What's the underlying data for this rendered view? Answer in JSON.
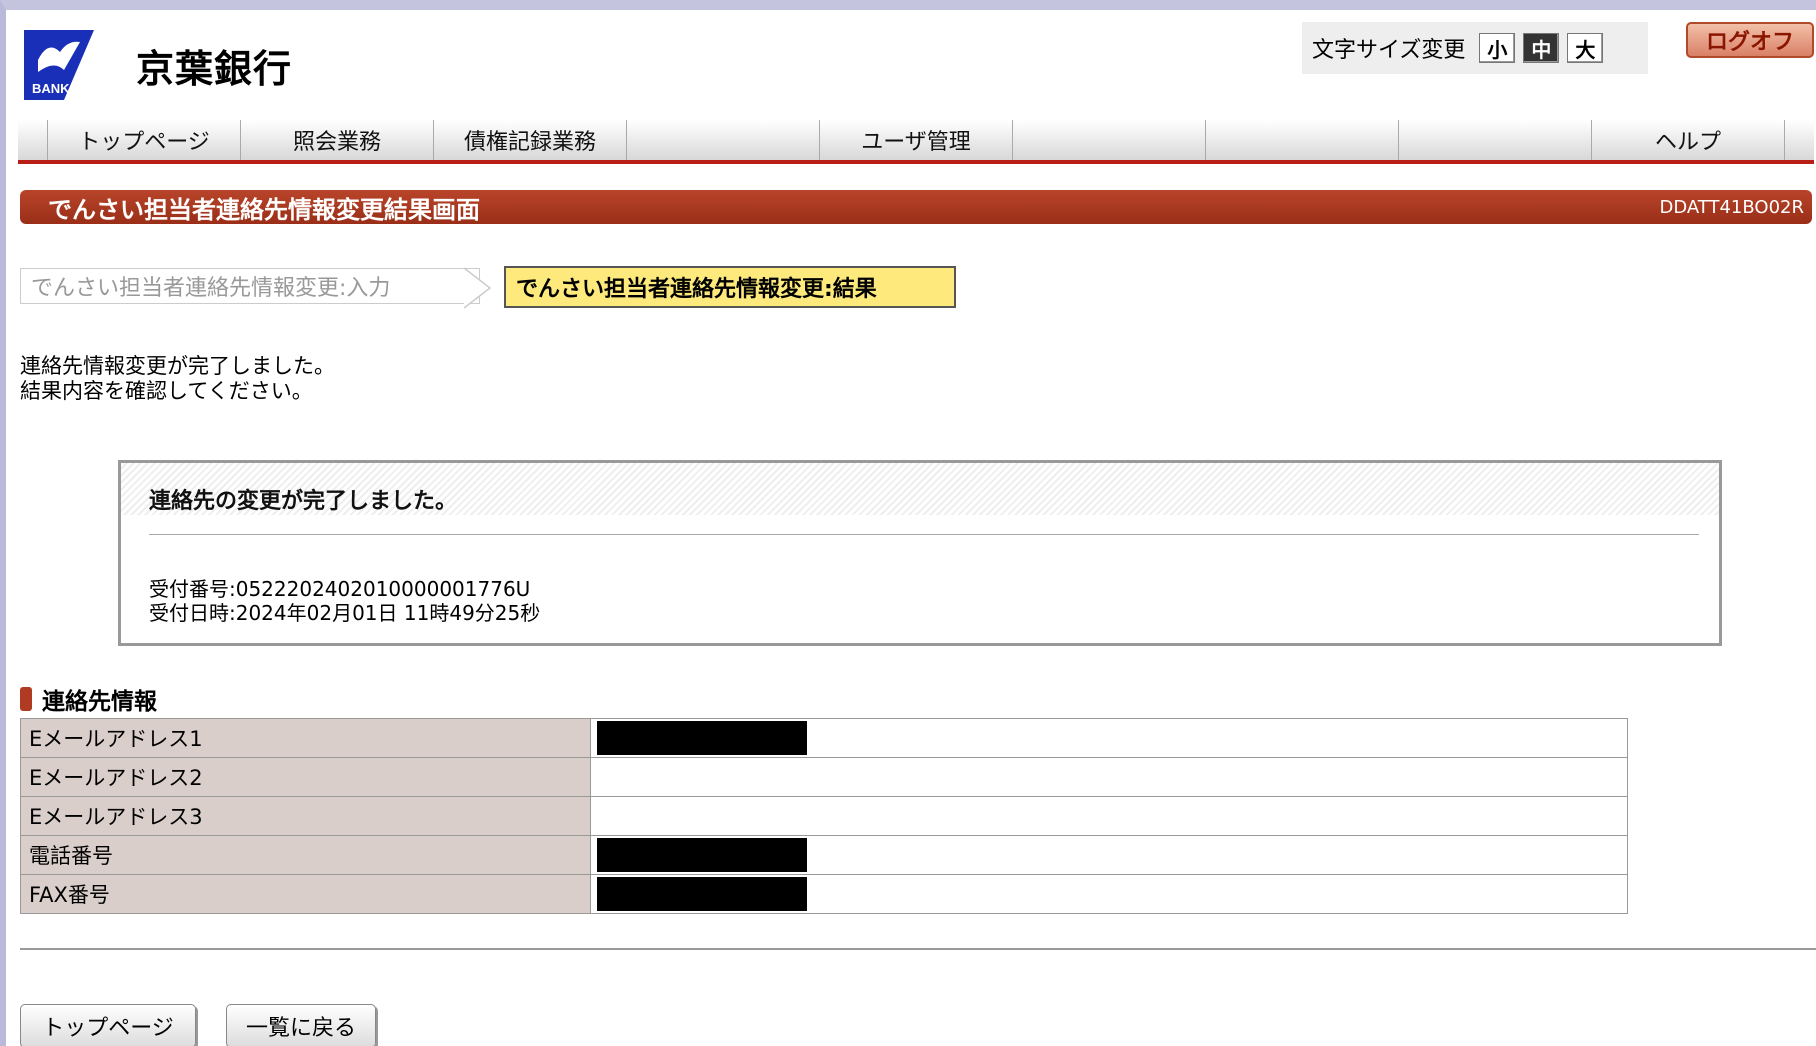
{
  "header": {
    "bank_name": "京葉銀行",
    "logo_text": "BANK",
    "font_size_label": "文字サイズ変更",
    "font_size_options": [
      "小",
      "中",
      "大"
    ],
    "font_size_selected": "中",
    "logoff_label": "ログオフ"
  },
  "nav": {
    "items": [
      "トップページ",
      "照会業務",
      "債権記録業務",
      "",
      "ユーザ管理",
      "",
      "",
      "",
      "ヘルプ"
    ]
  },
  "title_bar": {
    "title": "でんさい担当者連絡先情報変更結果画面",
    "screen_code": "DDATT41BO02R"
  },
  "steps": {
    "input": "でんさい担当者連絡先情報変更:入力",
    "result": "でんさい担当者連絡先情報変更:結果"
  },
  "message": {
    "line1": "連絡先情報変更が完了しました。",
    "line2": "結果内容を確認してください。"
  },
  "result": {
    "title": "連絡先の変更が完了しました。",
    "receipt_number": "受付番号:0522202402010000001776U",
    "receipt_datetime": "受付日時:2024年02月01日 11時49分25秒"
  },
  "contact_section": {
    "title": "連絡先情報",
    "rows": [
      {
        "label": "Eメールアドレス1",
        "redacted": true
      },
      {
        "label": "Eメールアドレス2",
        "redacted": false
      },
      {
        "label": "Eメールアドレス3",
        "redacted": false
      },
      {
        "label": "電話番号",
        "redacted": true
      },
      {
        "label": "FAX番号",
        "redacted": true
      }
    ]
  },
  "buttons": {
    "top_page": "トップページ",
    "back_to_list": "一覧に戻る"
  },
  "colors": {
    "title_bar": "#a83a20",
    "active_step": "#fde97c",
    "nav_accent": "#b91e16",
    "logo_blue": "#1a2fb8"
  }
}
